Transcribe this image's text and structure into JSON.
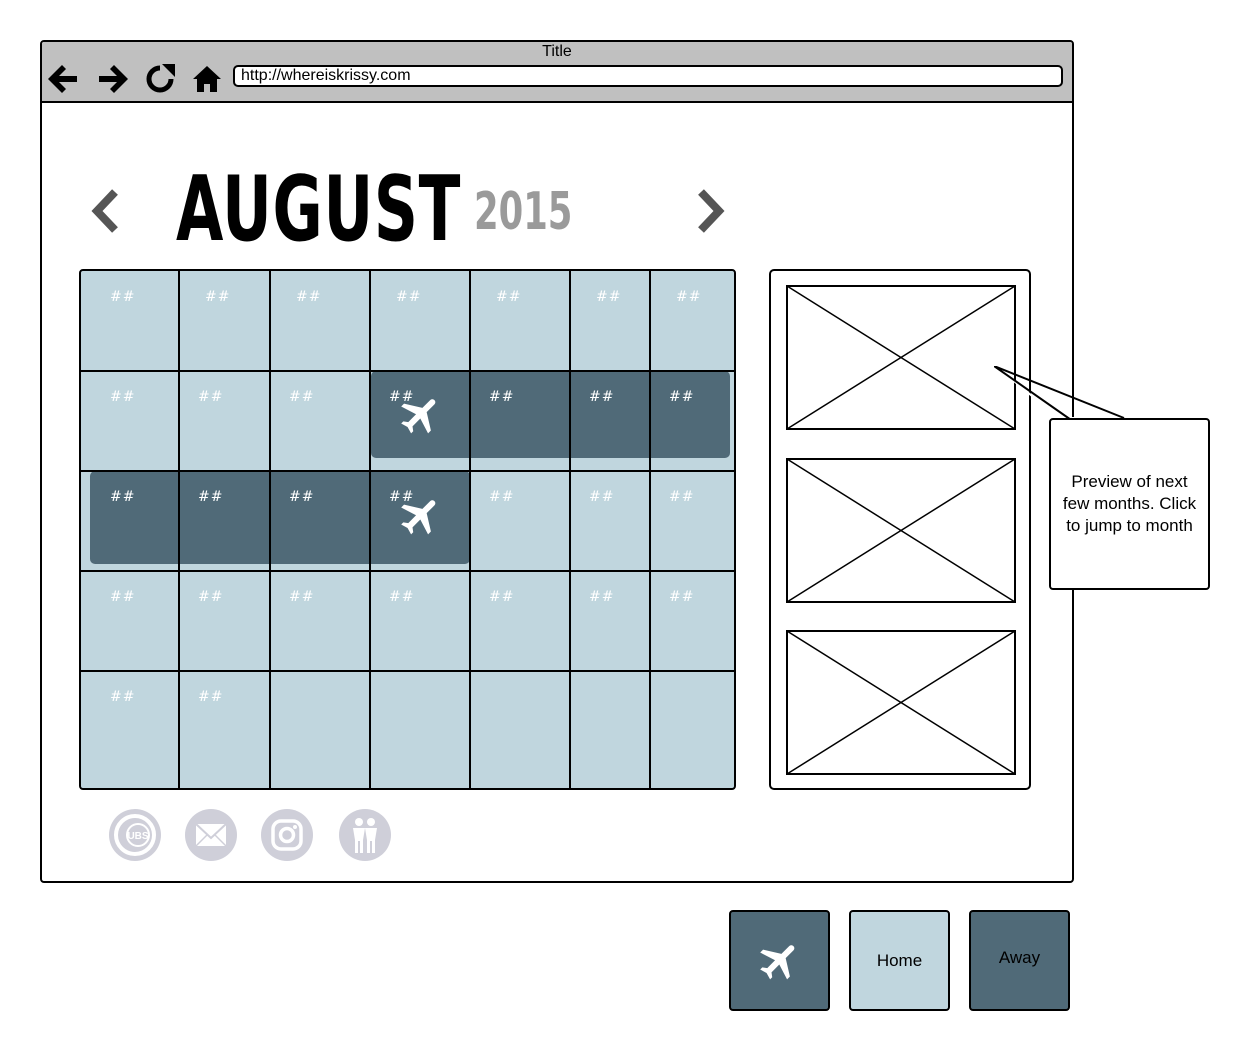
{
  "browser": {
    "title": "Title",
    "url": "http://whereiskrissy.com",
    "buttons": [
      "back",
      "forward",
      "reload",
      "home"
    ]
  },
  "calendar": {
    "month": "AUGUST",
    "year": "2015",
    "prev_icon": "chevron-left-icon",
    "next_icon": "chevron-right-icon",
    "day_placeholder": "##",
    "rows": [
      [
        "##",
        "##",
        "##",
        "##",
        "##",
        "##",
        "##"
      ],
      [
        "##",
        "##",
        "##",
        "##",
        "##",
        "##",
        "##"
      ],
      [
        "##",
        "##",
        "##",
        "##",
        "##",
        "##",
        "##"
      ],
      [
        "##",
        "##",
        "##",
        "##",
        "##",
        "##",
        "##"
      ],
      [
        "##",
        "##",
        "",
        "",
        "",
        "",
        ""
      ]
    ],
    "travel_icon": "airplane-icon"
  },
  "preview": {
    "thumbnails": 3,
    "callout": "Preview of next few months. Click to jump to month"
  },
  "social_icons": [
    "cubs-logo-icon",
    "mail-icon",
    "instagram-icon",
    "find-friends-icon"
  ],
  "legend": {
    "travel_icon": "airplane-icon",
    "home_label": "Home",
    "away_label": "Away"
  },
  "colors": {
    "home": "#c0d6de",
    "away": "#506a78",
    "chrome": "#c0c0c0",
    "year": "#9a9a9a",
    "social": "#cfcfd9"
  }
}
